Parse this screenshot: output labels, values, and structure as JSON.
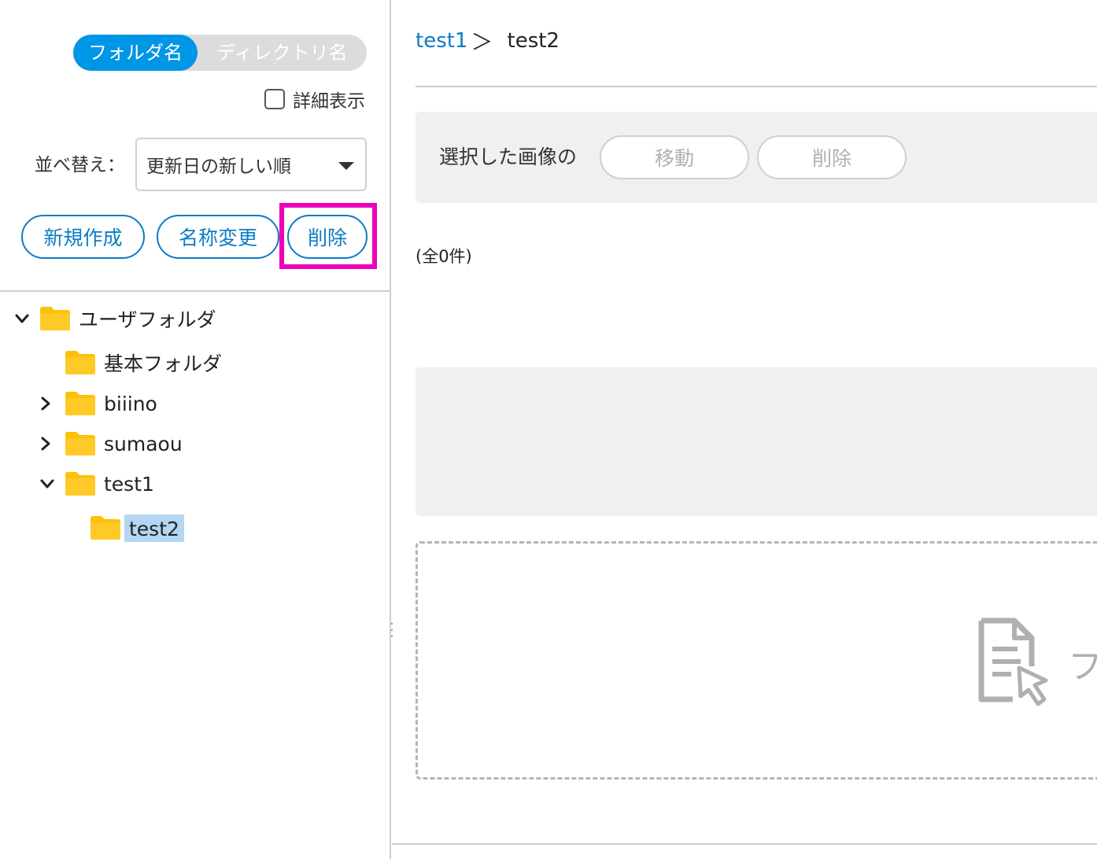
{
  "view_toggle": {
    "active_label": "フォルダ名",
    "inactive_label": "ディレクトリ名"
  },
  "detail_checkbox": {
    "label": "詳細表示",
    "checked": false
  },
  "sort": {
    "label": "並べ替え：",
    "selected": "更新日の新しい順"
  },
  "folder_actions": {
    "new_label": "新規作成",
    "rename_label": "名称変更",
    "delete_label": "削除"
  },
  "tree": {
    "items": [
      {
        "label": "ユーザフォルダ",
        "expanded": true,
        "has_children": true
      },
      {
        "label": "基本フォルダ",
        "expanded": false,
        "has_children": false
      },
      {
        "label": "biiino",
        "expanded": false,
        "has_children": true
      },
      {
        "label": "sumaou",
        "expanded": false,
        "has_children": true
      },
      {
        "label": "test1",
        "expanded": true,
        "has_children": true
      },
      {
        "label": "test2",
        "expanded": false,
        "has_children": false,
        "selected": true
      }
    ]
  },
  "breadcrumb": {
    "parent": "test1",
    "separator": "＞",
    "current": "test2"
  },
  "image_actions": {
    "label": "選択した画像の",
    "move_label": "移動",
    "delete_label": "削除"
  },
  "count_text": "(全0件)",
  "drop_zone": {
    "text_partial": "フ",
    "icon": "file-drop-icon"
  },
  "colors": {
    "accent": "#0096e6",
    "link": "#0a7dc4",
    "highlight": "#ee00bb",
    "folder": "#ffc107",
    "selection": "#b3d7f2"
  }
}
